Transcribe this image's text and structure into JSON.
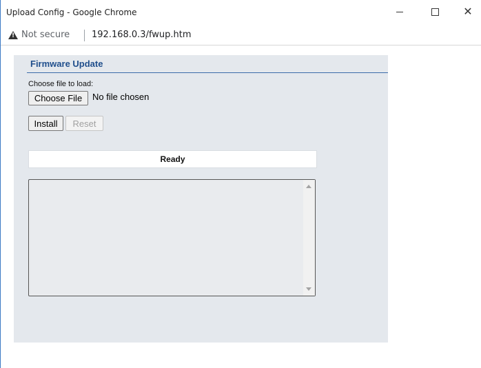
{
  "window": {
    "title": "Upload Config - Google Chrome",
    "minimize_icon": "minimize-icon",
    "maximize_icon": "maximize-icon",
    "close_icon": "close-icon",
    "close_glyph": "✕"
  },
  "addressbar": {
    "security_icon": "warning-triangle-icon",
    "security_text": "Not secure",
    "url": "192.168.0.3/fwup.htm"
  },
  "panel": {
    "heading": "Firmware Update",
    "choose_label": "Choose file to load:",
    "choose_button": "Choose File",
    "file_status": "No file chosen",
    "install_button": "Install",
    "reset_button": "Reset",
    "status": "Ready",
    "log_text": ""
  },
  "colors": {
    "heading": "#1f4e8c",
    "panel_bg": "#e4e8ed",
    "window_border": "#3b79c4"
  }
}
